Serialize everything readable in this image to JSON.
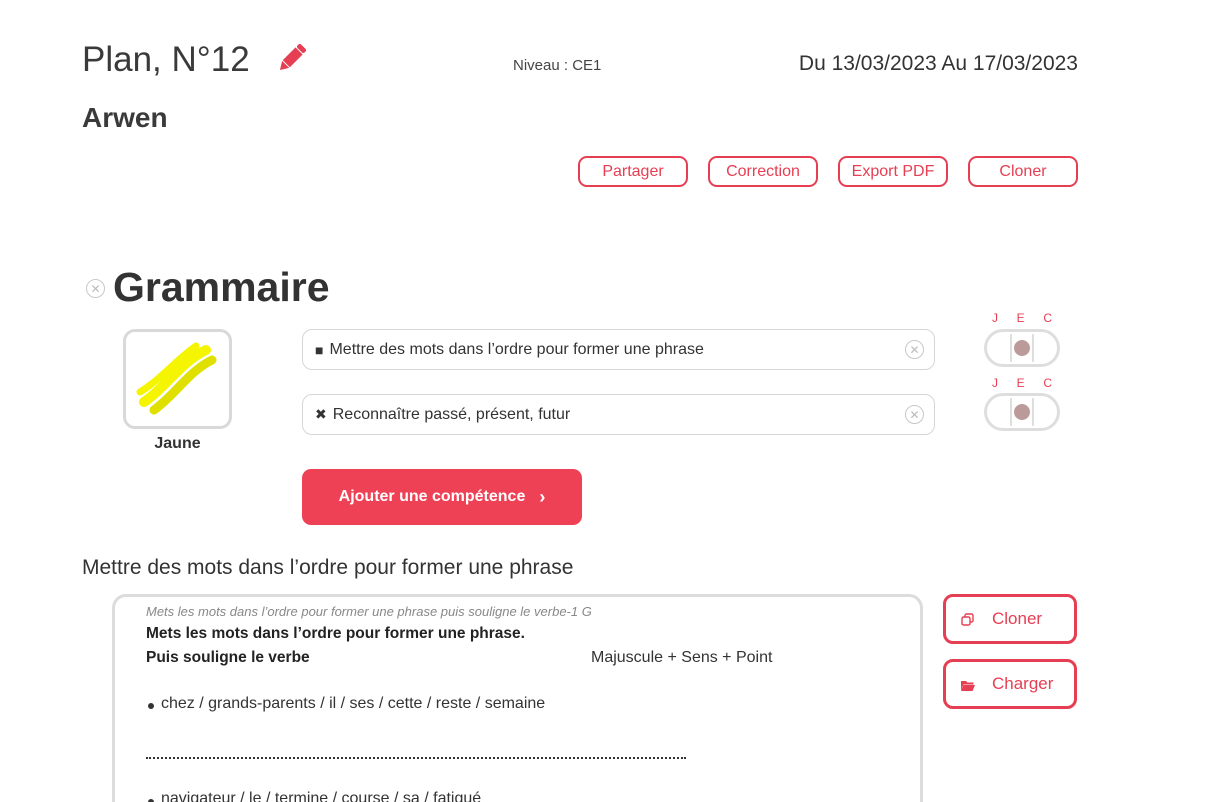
{
  "header": {
    "plan_title": "Plan, N°12",
    "niveau": "Niveau : CE1",
    "dates": "Du 13/03/2023 Au 17/03/2023",
    "student_name": "Arwen",
    "edit_icon": "pencil-icon"
  },
  "actions": {
    "share": "Partager",
    "correction": "Correction",
    "export_pdf": "Export PDF",
    "clone": "Cloner"
  },
  "section": {
    "title": "Grammaire",
    "level": {
      "label": "Jaune",
      "icon": "yellow-belt-icon",
      "color": "#f5f500"
    },
    "competences": [
      {
        "marker": "■",
        "label": "Mettre des mots dans l’ordre pour former une phrase",
        "jec": [
          "J",
          "E",
          "C"
        ]
      },
      {
        "marker": "✖",
        "label": "Reconnaître passé, présent, futur",
        "jec": [
          "J",
          "E",
          "C"
        ]
      }
    ],
    "add_button": "Ajouter une compétence"
  },
  "exercise": {
    "heading": "Mettre des mots dans l’ordre pour former une phrase",
    "reference": "Mets les mots dans l’ordre pour former une phrase puis souligne le verbe-1 G",
    "instruction_line1": "Mets les mots dans l’ordre pour former une phrase.",
    "instruction_line2": "Puis souligne le verbe",
    "criteria": "Majuscule + Sens + Point",
    "items": [
      "chez / grands-parents / il / ses / cette / reste / semaine",
      "navigateur / le / termine / course / sa / fatigué"
    ],
    "clone_button": "Cloner",
    "load_button": "Charger"
  },
  "colors": {
    "accent": "#e63e52",
    "accent_fill": "#ef4155",
    "jec_dot": "#bc9a9a"
  }
}
